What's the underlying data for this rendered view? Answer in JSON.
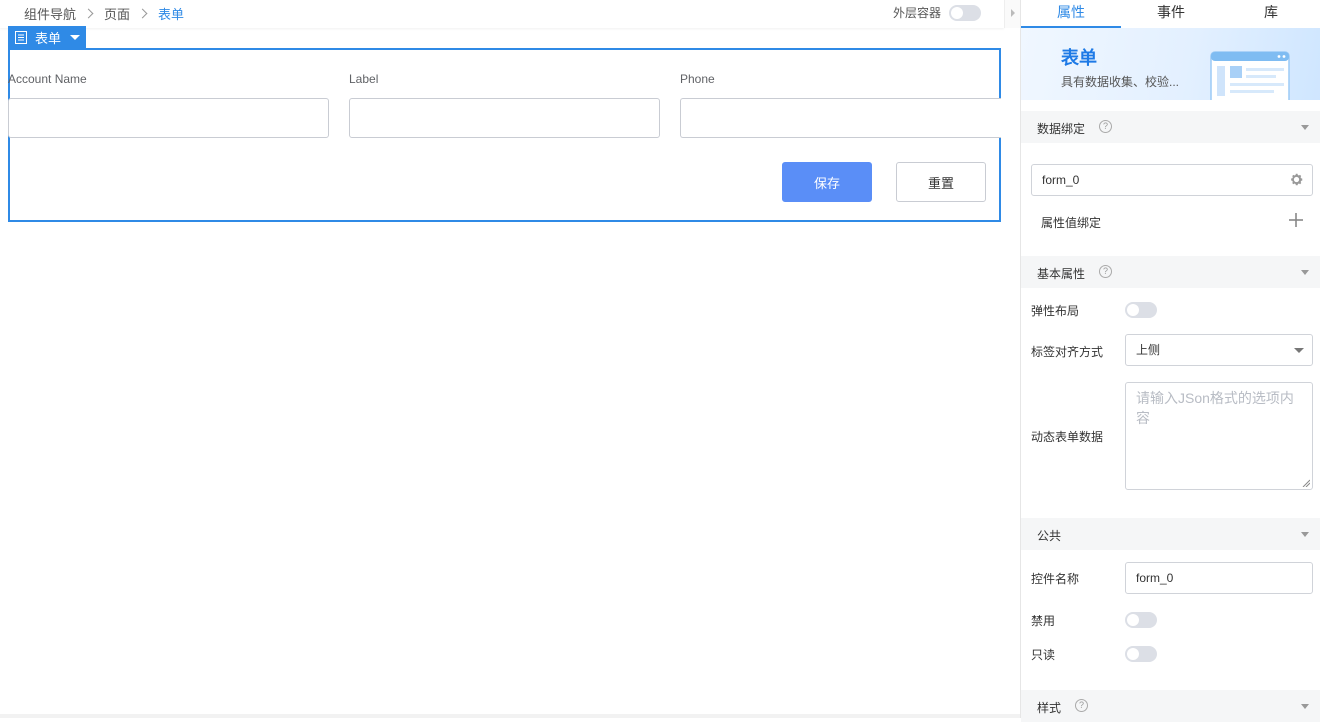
{
  "breadcrumb": [
    "组件导航",
    "页面",
    "表单"
  ],
  "topbar": {
    "outer_container_label": "外层容器"
  },
  "form_component": {
    "tag_label": "表单",
    "fields": [
      {
        "label": "Account Name",
        "value": ""
      },
      {
        "label": "Label",
        "value": ""
      },
      {
        "label": "Phone",
        "value": ""
      }
    ],
    "save_label": "保存",
    "reset_label": "重置"
  },
  "panel": {
    "tabs": [
      "属性",
      "事件",
      "库"
    ],
    "banner": {
      "title": "表单",
      "desc": "具有数据收集、校验..."
    },
    "data_binding": {
      "title": "数据绑定",
      "help": "?",
      "bound_value": "form_0",
      "prop_binding_label": "属性值绑定"
    },
    "basic": {
      "title": "基本属性",
      "help": "?",
      "flex_layout_label": "弹性布局",
      "label_align_label": "标签对齐方式",
      "label_align_value": "上侧",
      "dynamic_data_label": "动态表单数据",
      "dynamic_data_placeholder": "请输入JSon格式的选项内容"
    },
    "common": {
      "title": "公共",
      "control_name_label": "控件名称",
      "control_name_value": "form_0",
      "disabled_label": "禁用",
      "readonly_label": "只读"
    },
    "style": {
      "title": "样式",
      "help": "?"
    }
  },
  "colors": {
    "accent": "#2f8ae6",
    "primary_button": "#5a8ef7",
    "section_bg": "#f5f6f7"
  }
}
